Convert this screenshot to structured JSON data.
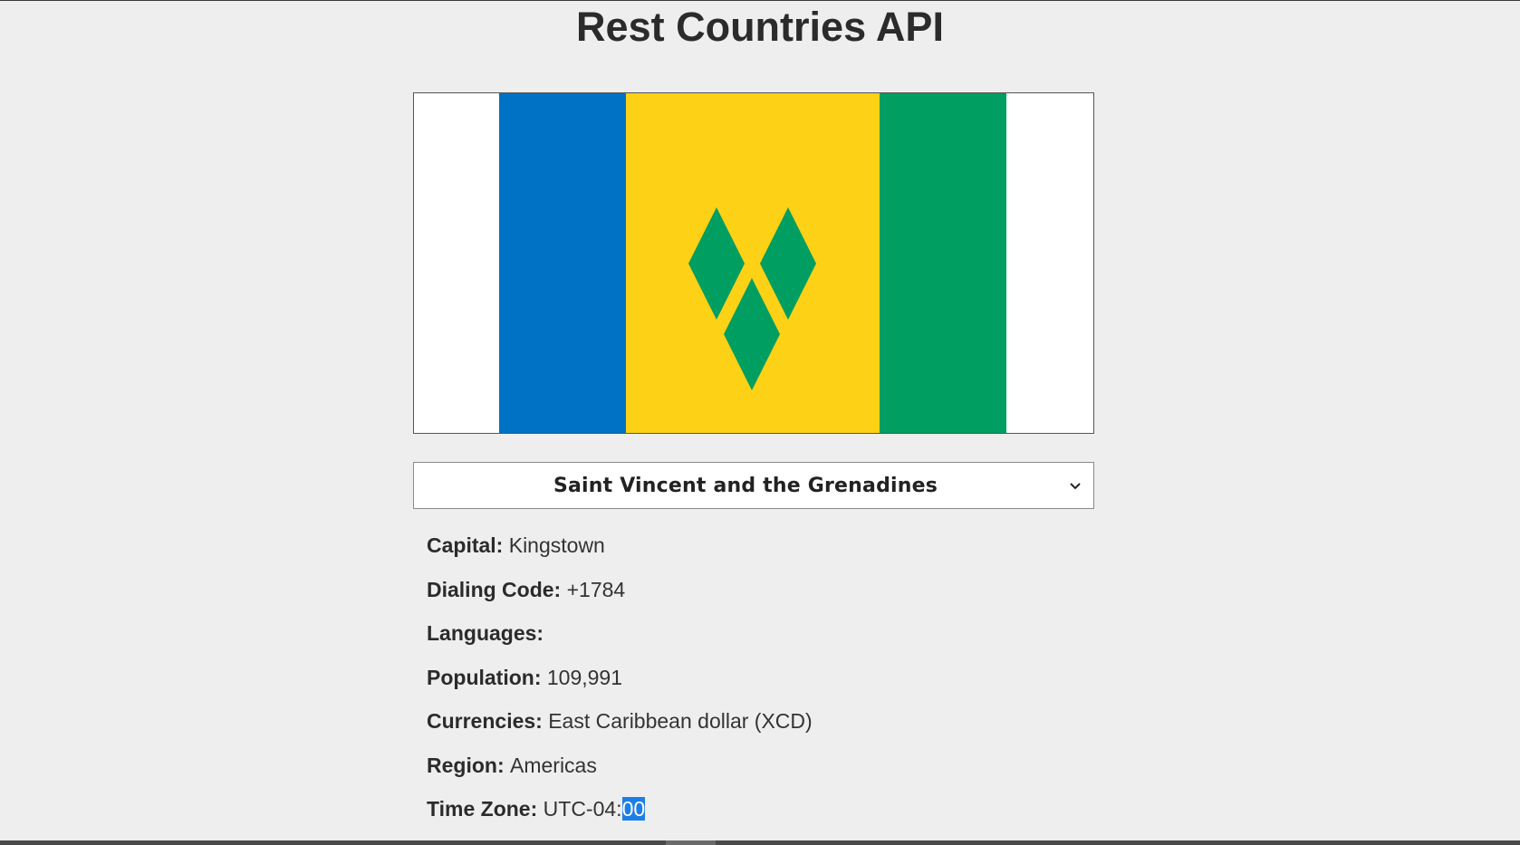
{
  "header": {
    "title": "Rest Countries API"
  },
  "flag": {
    "colors": {
      "blue": "#0072C6",
      "yellow": "#FCD116",
      "green": "#009E60",
      "background": "#FFFFFF"
    },
    "alt": "Flag of Saint Vincent and the Grenadines"
  },
  "country_select": {
    "selected": "Saint Vincent and the Grenadines"
  },
  "details": {
    "capital": {
      "label": "Capital:",
      "value": "Kingstown"
    },
    "dialing_code": {
      "label": "Dialing Code:",
      "value": "+1784"
    },
    "languages": {
      "label": "Languages:",
      "value": ""
    },
    "population": {
      "label": "Population:",
      "value": "109,991"
    },
    "currencies": {
      "label": "Currencies:",
      "value": "East Caribbean dollar (XCD)"
    },
    "region": {
      "label": "Region:",
      "value": "Americas"
    },
    "time_zone": {
      "label": "Time Zone:",
      "value_prefix": "UTC-04:",
      "value_selected": "00"
    }
  }
}
